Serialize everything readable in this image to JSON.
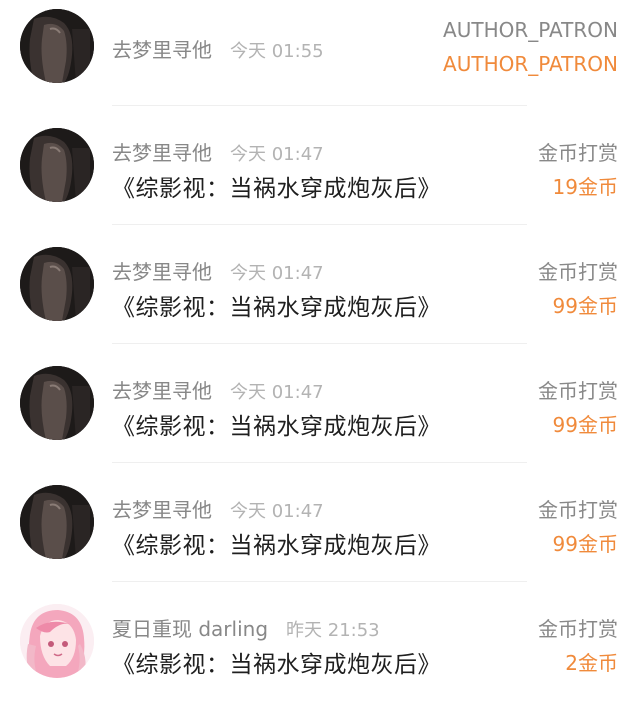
{
  "colors": {
    "accent_orange": "#f08a3b",
    "name_gray": "#888888",
    "time_gray": "#b3b3b3",
    "title_text": "#1f1f1f",
    "divider": "#efefef"
  },
  "items": [
    {
      "user": "去梦里寻他",
      "time": "今天 01:55",
      "title": "",
      "label_top": "AUTHOR_PATRON",
      "label_bottom": "AUTHOR_PATRON",
      "avatar": "dark-photo"
    },
    {
      "user": "去梦里寻他",
      "time": "今天 01:47",
      "title": "《综影视：当祸水穿成炮灰后》",
      "label_top": "金币打赏",
      "label_bottom": "19金币",
      "avatar": "dark-photo"
    },
    {
      "user": "去梦里寻他",
      "time": "今天 01:47",
      "title": "《综影视：当祸水穿成炮灰后》",
      "label_top": "金币打赏",
      "label_bottom": "99金币",
      "avatar": "dark-photo"
    },
    {
      "user": "去梦里寻他",
      "time": "今天 01:47",
      "title": "《综影视：当祸水穿成炮灰后》",
      "label_top": "金币打赏",
      "label_bottom": "99金币",
      "avatar": "dark-photo"
    },
    {
      "user": "去梦里寻他",
      "time": "今天 01:47",
      "title": "《综影视：当祸水穿成炮灰后》",
      "label_top": "金币打赏",
      "label_bottom": "99金币",
      "avatar": "dark-photo"
    },
    {
      "user": "夏日重现 darling",
      "time": "昨天 21:53",
      "title": "《综影视：当祸水穿成炮灰后》",
      "label_top": "金币打赏",
      "label_bottom": "2金币",
      "avatar": "pink-anime"
    }
  ]
}
